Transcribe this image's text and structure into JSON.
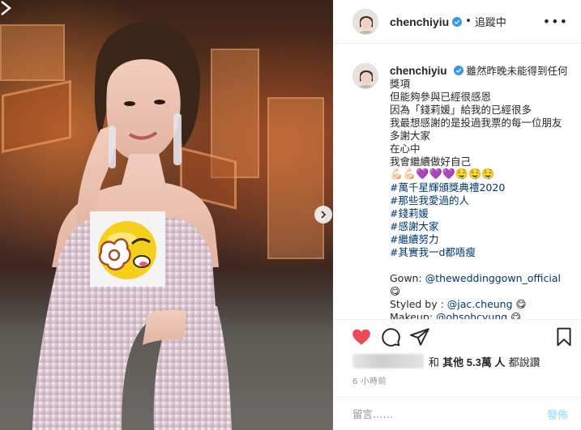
{
  "post": {
    "username": "chenchiyiu",
    "follow_status": "追蹤中",
    "separator": "•",
    "more": "•••"
  },
  "caption": {
    "username": "chenchiyiu",
    "lines": [
      "雖然昨晚未能得到任何獎項",
      "但能夠參與已經很感恩",
      "因為「錢莉媛」給我的已經很多",
      "我最想感謝的是投過我票的每一位朋友",
      "多謝大家",
      "在心中",
      "我會繼續做好自己"
    ],
    "emoji_row": "💪🏻💪🏻💜💜💜🤤🤤🤤",
    "hashtags": [
      "#萬千星輝頒獎典禮2020",
      "#那些我愛過的人",
      "#錢莉媛",
      "#感謝大家",
      "#繼續努力",
      "#其實我一d都唔瘦"
    ],
    "credits": [
      {
        "label": "Gown: ",
        "handle": "@theweddinggown_official",
        "emoji": "😋"
      },
      {
        "label": "Styled by : ",
        "handle": "@jac.cheung",
        "emoji": "😋"
      },
      {
        "label": "Makeup: ",
        "handle": "@ohsohcyung",
        "emoji": "😋"
      }
    ]
  },
  "likes": {
    "text_prefix": "和 ",
    "others": "其他 5.3萬 人",
    "text_suffix": " 都說讚"
  },
  "time_ago": "6 小時前",
  "comment_box": {
    "placeholder": "留言……",
    "post_label": "發佈"
  },
  "icons": {
    "like": "heart-icon",
    "comment": "comment-icon",
    "share": "share-icon",
    "save": "bookmark-icon",
    "next": "chevron-right-icon",
    "verified": "verified-badge-icon"
  },
  "colors": {
    "heart": "#ed4956",
    "link": "#00376b",
    "verified": "#3897f0",
    "post_button": "#b2dffc"
  }
}
